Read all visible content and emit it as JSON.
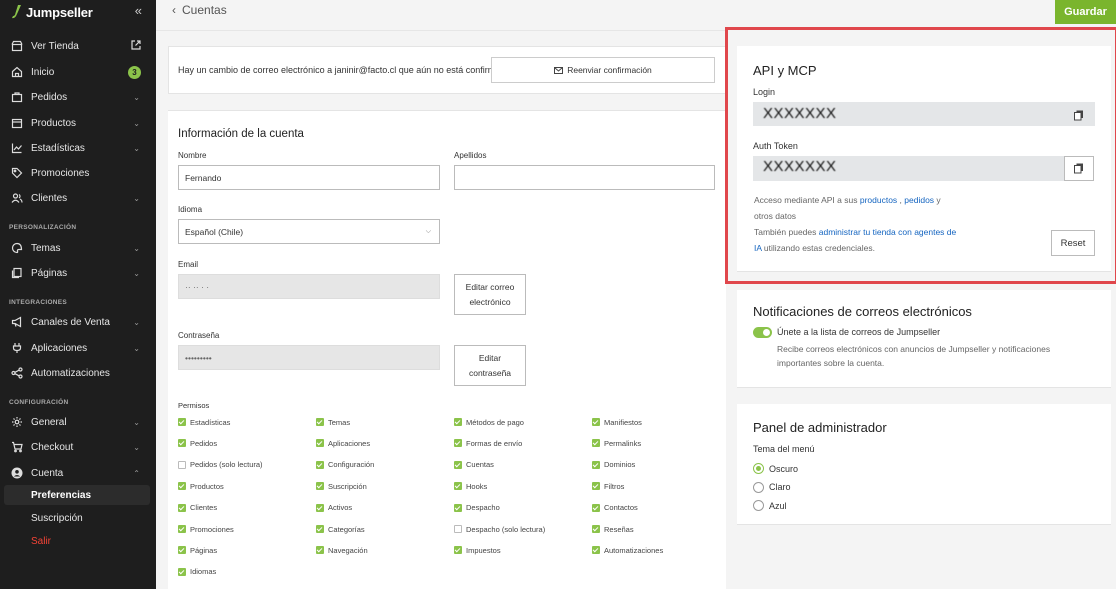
{
  "brand": {
    "name": "Jumpseller"
  },
  "sidebar": {
    "collapse_icon": "«",
    "items": [
      {
        "label": "Ver Tienda",
        "icon": "store-icon",
        "external": true
      },
      {
        "label": "Inicio",
        "icon": "home-icon",
        "badge": "3"
      },
      {
        "label": "Pedidos",
        "icon": "bag-icon"
      },
      {
        "label": "Productos",
        "icon": "box-icon"
      },
      {
        "label": "Estadísticas",
        "icon": "chart-icon"
      },
      {
        "label": "Promociones",
        "icon": "tag-icon"
      },
      {
        "label": "Clientes",
        "icon": "users-icon"
      }
    ],
    "section_personalizacion": "PERSONALIZACIÓN",
    "personalizacion": [
      {
        "label": "Temas",
        "icon": "palette-icon"
      },
      {
        "label": "Páginas",
        "icon": "pages-icon"
      }
    ],
    "section_integraciones": "INTEGRACIONES",
    "integraciones": [
      {
        "label": "Canales de Venta",
        "icon": "megaphone-icon"
      },
      {
        "label": "Aplicaciones",
        "icon": "plug-icon"
      },
      {
        "label": "Automatizaciones",
        "icon": "share-icon"
      }
    ],
    "section_configuracion": "CONFIGURACIÓN",
    "configuracion": [
      {
        "label": "General",
        "icon": "gear-icon"
      },
      {
        "label": "Checkout",
        "icon": "cart-icon"
      },
      {
        "label": "Cuenta",
        "icon": "user-circle-icon"
      }
    ],
    "cuenta_sub": {
      "preferencias": "Preferencias",
      "suscripcion": "Suscripción",
      "salir": "Salir"
    }
  },
  "header": {
    "back_label": "Cuentas",
    "save_label": "Guardar"
  },
  "notice": {
    "text": "Hay un cambio de correo electrónico a janinir@facto.cl que aún no está confirmado.",
    "resend_label": "Reenviar confirmación"
  },
  "account": {
    "title": "Información de la cuenta",
    "nombre_label": "Nombre",
    "nombre_value": "Fernando",
    "apellidos_label": "Apellidos",
    "apellidos_value": "",
    "idioma_label": "Idioma",
    "idioma_value": "Español (Chile)",
    "email_label": "Email",
    "email_value": "·· ·· ·   ·",
    "edit_email_line1": "Editar correo",
    "edit_email_line2": "electrónico",
    "password_label": "Contraseña",
    "password_value": "•••••••••",
    "edit_password_line1": "Editar",
    "edit_password_line2": "contraseña",
    "permisos_label": "Permisos",
    "permisos": [
      [
        {
          "label": "Estadísticas",
          "checked": true
        },
        {
          "label": "Pedidos",
          "checked": true
        },
        {
          "label": "Pedidos (solo lectura)",
          "checked": false
        },
        {
          "label": "Productos",
          "checked": true
        },
        {
          "label": "Clientes",
          "checked": true
        },
        {
          "label": "Promociones",
          "checked": true
        },
        {
          "label": "Páginas",
          "checked": true
        },
        {
          "label": "Idiomas",
          "checked": true
        }
      ],
      [
        {
          "label": "Temas",
          "checked": true
        },
        {
          "label": "Aplicaciones",
          "checked": true
        },
        {
          "label": "Configuración",
          "checked": true
        },
        {
          "label": "Suscripción",
          "checked": true
        },
        {
          "label": "Activos",
          "checked": true
        },
        {
          "label": "Categorías",
          "checked": true
        },
        {
          "label": "Navegación",
          "checked": true
        }
      ],
      [
        {
          "label": "Métodos de pago",
          "checked": true
        },
        {
          "label": "Formas de envío",
          "checked": true
        },
        {
          "label": "Cuentas",
          "checked": true
        },
        {
          "label": "Hooks",
          "checked": true
        },
        {
          "label": "Despacho",
          "checked": true
        },
        {
          "label": "Despacho (solo lectura)",
          "checked": false
        },
        {
          "label": "Impuestos",
          "checked": true
        }
      ],
      [
        {
          "label": "Manifiestos",
          "checked": true
        },
        {
          "label": "Permalinks",
          "checked": true
        },
        {
          "label": "Dominios",
          "checked": true
        },
        {
          "label": "Filtros",
          "checked": true
        },
        {
          "label": "Contactos",
          "checked": true
        },
        {
          "label": "Reseñas",
          "checked": true
        },
        {
          "label": "Automatizaciones",
          "checked": true
        }
      ]
    ]
  },
  "api": {
    "title": "API y MCP",
    "login_label": "Login",
    "login_value": "XXXXXXX",
    "token_label": "Auth Token",
    "token_value": "XXXXXXX",
    "desc1_a": "Acceso mediante API a sus ",
    "desc1_link1": "productos",
    "desc1_sep": " , ",
    "desc1_link2": "pedidos",
    "desc1_b": " y",
    "desc2": "otros datos",
    "desc3_a": "También puedes ",
    "desc3_link": "administrar tu tienda con agentes de",
    "desc4_link": "IA",
    "desc4_b": " utilizando estas credenciales.",
    "reset_label": "Reset"
  },
  "notifications": {
    "title": "Notificaciones de correos electrónicos",
    "toggle_label": "Únete a la lista de correos de Jumpseller",
    "toggle_on": true,
    "desc_line1": "Recibe correos electrónicos con anuncios de Jumpseller y notificaciones",
    "desc_line2": "importantes sobre la cuenta."
  },
  "admin": {
    "title": "Panel de administrador",
    "theme_label": "Tema del menú",
    "options": [
      {
        "label": "Oscuro",
        "selected": true
      },
      {
        "label": "Claro",
        "selected": false
      },
      {
        "label": "Azul",
        "selected": false
      }
    ]
  },
  "colors": {
    "accent": "#7ab52d",
    "sidebar_bg": "#1e1e1e",
    "link": "#1565c0",
    "highlight_frame": "#e0474c",
    "danger": "#f44336"
  }
}
